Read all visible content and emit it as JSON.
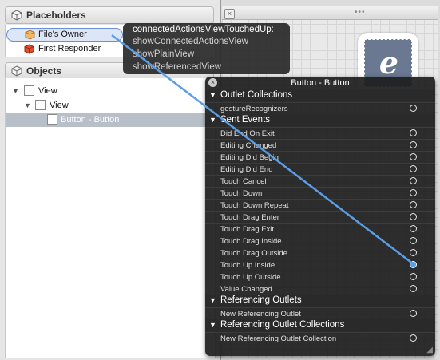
{
  "placeholders": {
    "header": "Placeholders",
    "items": [
      {
        "label": "File's Owner",
        "icon": "cube-icon"
      },
      {
        "label": "First Responder",
        "icon": "red-cube-icon"
      }
    ]
  },
  "objects": {
    "header": "Objects",
    "items": [
      {
        "label": "View",
        "level": 0
      },
      {
        "label": "View",
        "level": 1
      },
      {
        "label": "Button - Button",
        "level": 2,
        "selected": true
      }
    ]
  },
  "actions_popover": {
    "title": "connectedActionsViewTouchedUp:",
    "items": [
      "showConnectedActionsView",
      "showPlainView",
      "showReferencedView"
    ]
  },
  "hud": {
    "title": "Button - Button",
    "sections": [
      {
        "label": "Outlet Collections",
        "rows": [
          {
            "label": "gestureRecognizers",
            "connected": false
          }
        ]
      },
      {
        "label": "Sent Events",
        "rows": [
          {
            "label": "Did End On Exit",
            "connected": false
          },
          {
            "label": "Editing Changed",
            "connected": false
          },
          {
            "label": "Editing Did Begin",
            "connected": false
          },
          {
            "label": "Editing Did End",
            "connected": false
          },
          {
            "label": "Touch Cancel",
            "connected": false
          },
          {
            "label": "Touch Down",
            "connected": false
          },
          {
            "label": "Touch Down Repeat",
            "connected": false
          },
          {
            "label": "Touch Drag Enter",
            "connected": false
          },
          {
            "label": "Touch Drag Exit",
            "connected": false
          },
          {
            "label": "Touch Drag Inside",
            "connected": false
          },
          {
            "label": "Touch Drag Outside",
            "connected": false
          },
          {
            "label": "Touch Up Inside",
            "connected": true
          },
          {
            "label": "Touch Up Outside",
            "connected": false
          },
          {
            "label": "Value Changed",
            "connected": false
          }
        ]
      },
      {
        "label": "Referencing Outlets",
        "rows": [
          {
            "label": "New Referencing Outlet",
            "connected": false
          }
        ]
      },
      {
        "label": "Referencing Outlet Collections",
        "rows": [
          {
            "label": "New Referencing Outlet Collection",
            "connected": false
          }
        ]
      }
    ]
  },
  "canvas": {
    "app_icon_letter": "e",
    "grip": "•••"
  },
  "colors": {
    "connection_line": "#5a9ee6",
    "selection": "#b9bfc9"
  }
}
